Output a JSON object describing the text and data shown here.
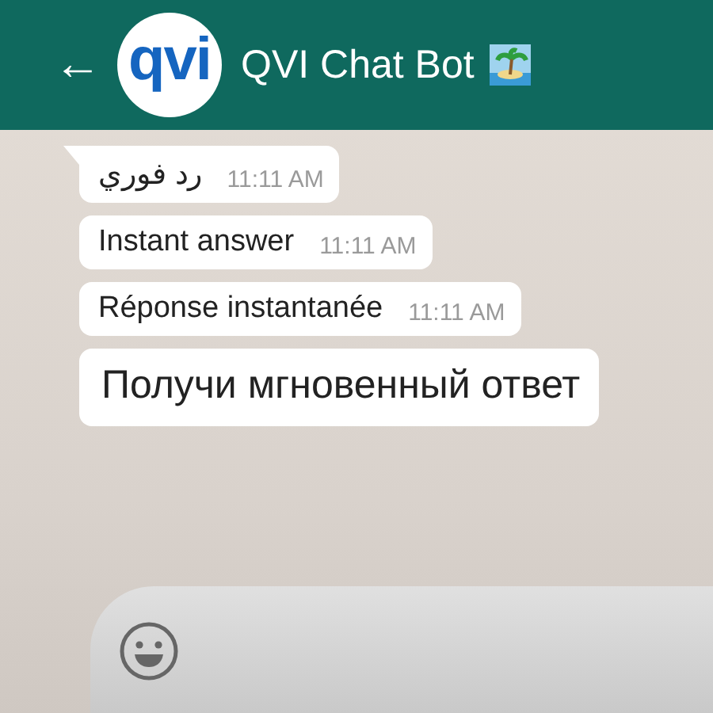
{
  "header": {
    "back": "←",
    "logo": "qvi",
    "title": "QVI Chat Bot"
  },
  "messages": [
    {
      "kind": "normal",
      "tail": true,
      "text": "رد فوري",
      "time": "11:11 AM"
    },
    {
      "kind": "normal",
      "tail": false,
      "text": "Instant answer",
      "time": "11:11 AM"
    },
    {
      "kind": "normal",
      "tail": false,
      "text": "Réponse instantanée",
      "time": "11:11 AM"
    },
    {
      "kind": "large",
      "tail": false,
      "text": "Получи мгновенный ответ"
    }
  ]
}
